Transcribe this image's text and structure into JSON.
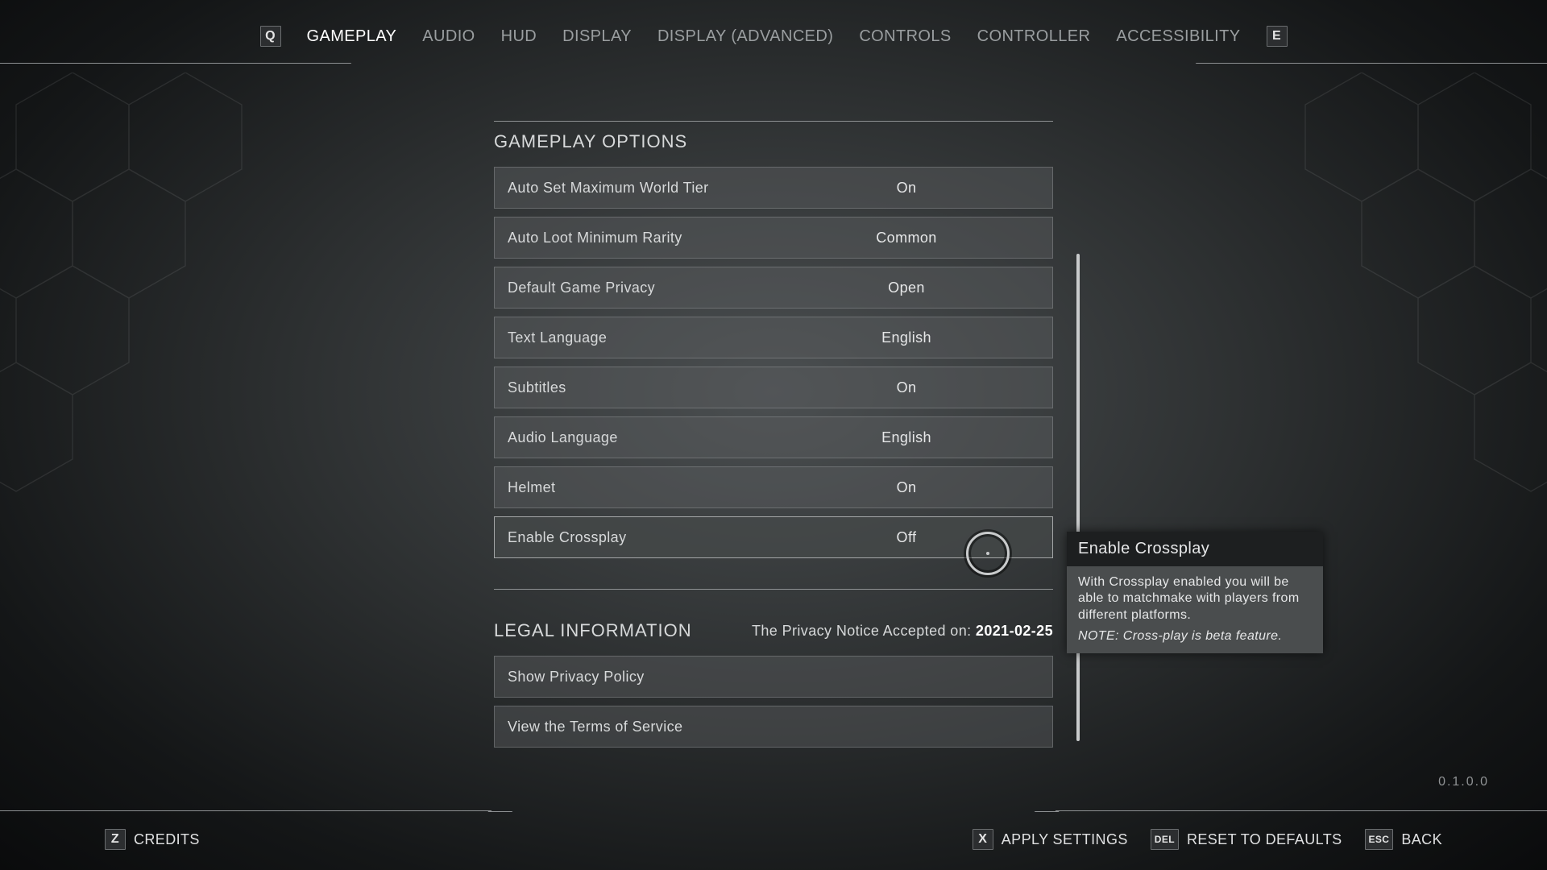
{
  "topbar": {
    "prev_key": "Q",
    "next_key": "E",
    "tabs": [
      {
        "label": "GAMEPLAY",
        "active": true
      },
      {
        "label": "AUDIO"
      },
      {
        "label": "HUD"
      },
      {
        "label": "DISPLAY"
      },
      {
        "label": "DISPLAY (ADVANCED)"
      },
      {
        "label": "CONTROLS"
      },
      {
        "label": "CONTROLLER"
      },
      {
        "label": "ACCESSIBILITY"
      }
    ]
  },
  "section": {
    "title": "GAMEPLAY OPTIONS",
    "rows": [
      {
        "label": "Auto Set Maximum World Tier",
        "value": "On"
      },
      {
        "label": "Auto Loot Minimum Rarity",
        "value": "Common"
      },
      {
        "label": "Default Game Privacy",
        "value": "Open"
      },
      {
        "label": "Text Language",
        "value": "English"
      },
      {
        "label": "Subtitles",
        "value": "On"
      },
      {
        "label": "Audio Language",
        "value": "English"
      },
      {
        "label": "Helmet",
        "value": "On"
      },
      {
        "label": "Enable Crossplay",
        "value": "Off",
        "selected": true
      }
    ]
  },
  "legal": {
    "title": "LEGAL INFORMATION",
    "accepted_prefix": "The Privacy Notice Accepted on: ",
    "accepted_date": "2021-02-25",
    "rows": [
      {
        "label": "Show Privacy Policy"
      },
      {
        "label": "View the Terms of Service"
      }
    ]
  },
  "tooltip": {
    "title": "Enable Crossplay",
    "body": "With Crossplay enabled you will be able to matchmake with players from different platforms.",
    "note": "NOTE: Cross-play is beta feature."
  },
  "version": "0.1.0.0",
  "footer": {
    "left": {
      "key": "Z",
      "label": "CREDITS"
    },
    "right": [
      {
        "key": "X",
        "label": "APPLY SETTINGS"
      },
      {
        "key": "DEL",
        "label": "RESET TO DEFAULTS"
      },
      {
        "key": "ESC",
        "label": "BACK"
      }
    ]
  }
}
